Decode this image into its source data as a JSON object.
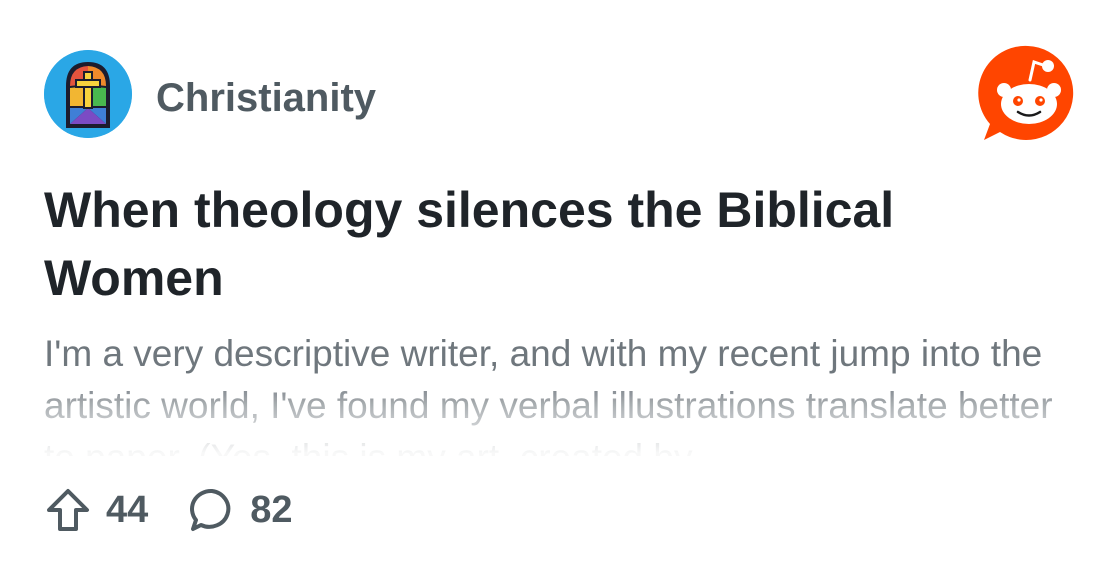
{
  "community": {
    "name": "Christianity",
    "avatar_icon": "stained-glass-cross-icon",
    "avatar_bg": "#2aa7e6"
  },
  "brand": {
    "logo_icon": "reddit-snoo-logo",
    "color": "#ff4500"
  },
  "post": {
    "title": "When theology silences the Biblical Women",
    "excerpt": "I'm a very descriptive writer, and with my recent jump into the artistic world, I've found my verbal illustrations translate better to paper. (Yes, this is my art, created by"
  },
  "stats": {
    "upvotes": "44",
    "upvote_icon": "upvote-arrow-icon",
    "comments": "82",
    "comment_icon": "comment-bubble-icon"
  },
  "colors": {
    "title": "#1f2429",
    "subtitle": "#4f5a61",
    "excerpt": "#6f777d"
  }
}
